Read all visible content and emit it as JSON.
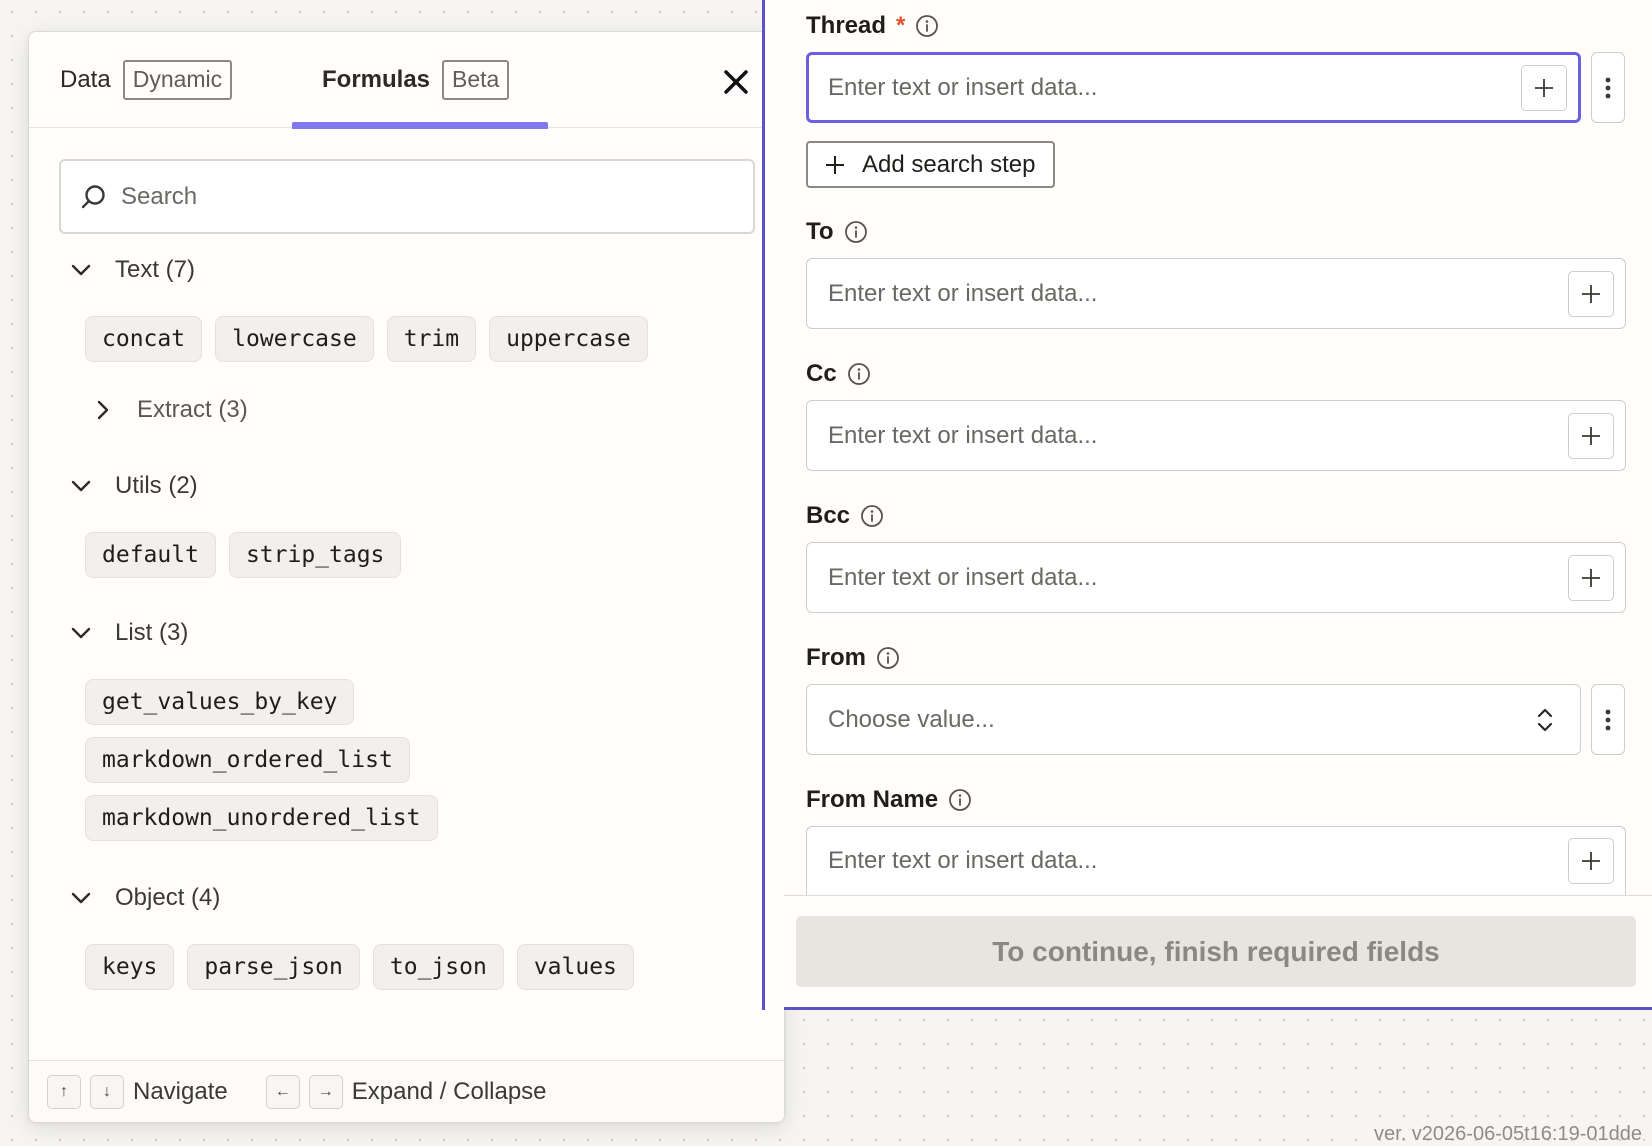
{
  "formulas_panel": {
    "tabs": [
      {
        "label": "Data",
        "badge": "Dynamic"
      },
      {
        "label": "Formulas",
        "badge": "Beta"
      }
    ],
    "active_tab": "Formulas",
    "search_placeholder": "Search",
    "sections": {
      "text": {
        "label": "Text (7)",
        "items": [
          "concat",
          "lowercase",
          "trim",
          "uppercase"
        ],
        "sub": {
          "label": "Extract (3)"
        }
      },
      "utils": {
        "label": "Utils (2)",
        "items": [
          "default",
          "strip_tags"
        ]
      },
      "list": {
        "label": "List (3)",
        "items": [
          "get_values_by_key",
          "markdown_ordered_list",
          "markdown_unordered_list"
        ]
      },
      "object": {
        "label": "Object (4)",
        "items": [
          "keys",
          "parse_json",
          "to_json",
          "values"
        ]
      }
    },
    "footer": {
      "up_key": "↑",
      "down_key": "↓",
      "navigate_label": "Navigate",
      "left_key": "←",
      "right_key": "→",
      "expand_label": "Expand / Collapse"
    }
  },
  "form": {
    "thread": {
      "label": "Thread",
      "required_mark": "*",
      "placeholder": "Enter text or insert data..."
    },
    "add_search_step": "Add search step",
    "to": {
      "label": "To",
      "placeholder": "Enter text or insert data..."
    },
    "cc": {
      "label": "Cc",
      "placeholder": "Enter text or insert data..."
    },
    "bcc": {
      "label": "Bcc",
      "placeholder": "Enter text or insert data..."
    },
    "from": {
      "label": "From",
      "value": "Choose value..."
    },
    "from_name": {
      "label": "From Name",
      "placeholder": "Enter text or insert data..."
    },
    "continue_button": "To continue, finish required fields"
  },
  "version": "ver. v2026-06-05t16:19-01dde",
  "colors": {
    "accent": "#8079f0",
    "focus": "#6a5fe0",
    "required": "#e0542b",
    "frame": "#5b52c8"
  }
}
